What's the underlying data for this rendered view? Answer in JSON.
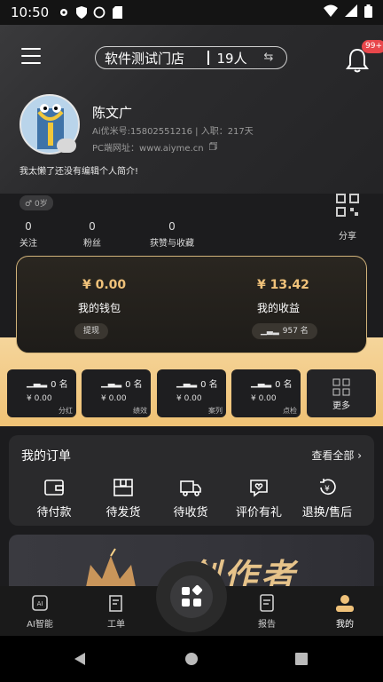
{
  "status_bar": {
    "time": "10:50"
  },
  "header": {
    "store_name": "软件测试门店",
    "member_count": "19人",
    "notification_badge": "99+"
  },
  "profile": {
    "name": "陈文广",
    "info": "Ai优米号:15802551216 | 入职：217天",
    "pc_label": "PC端网址：www.aiyme.cn",
    "bio": "我太懒了还没有编辑个人简介!",
    "gender_age": "0岁"
  },
  "stats": [
    {
      "value": "0",
      "label": "关注"
    },
    {
      "value": "0",
      "label": "粉丝"
    },
    {
      "value": "0",
      "label": "获赞与收藏"
    }
  ],
  "share": {
    "label": "分享"
  },
  "wallet": {
    "wallet_amount": "¥ 0.00",
    "wallet_label": "我的钱包",
    "withdraw_label": "提现",
    "income_amount": "¥ 13.42",
    "income_label": "我的收益",
    "rank_label": "957 名"
  },
  "mini_cards": [
    {
      "rank": "0 名",
      "value": "¥ 0.00",
      "tag": "分红"
    },
    {
      "rank": "0 名",
      "value": "¥ 0.00",
      "tag": "绩效"
    },
    {
      "rank": "0 名",
      "value": "¥ 0.00",
      "tag": "案列"
    },
    {
      "rank": "0 名",
      "value": "¥ 0.00",
      "tag": "点检"
    }
  ],
  "more_label": "更多",
  "orders": {
    "title": "我的订单",
    "view_all": "查看全部",
    "items": [
      "待付款",
      "待发货",
      "待收货",
      "评价有礼",
      "退换/售后"
    ]
  },
  "banner": {
    "text": "创作者"
  },
  "tabbar": {
    "items": [
      "AI智能",
      "工单",
      "报告",
      "我的"
    ]
  }
}
